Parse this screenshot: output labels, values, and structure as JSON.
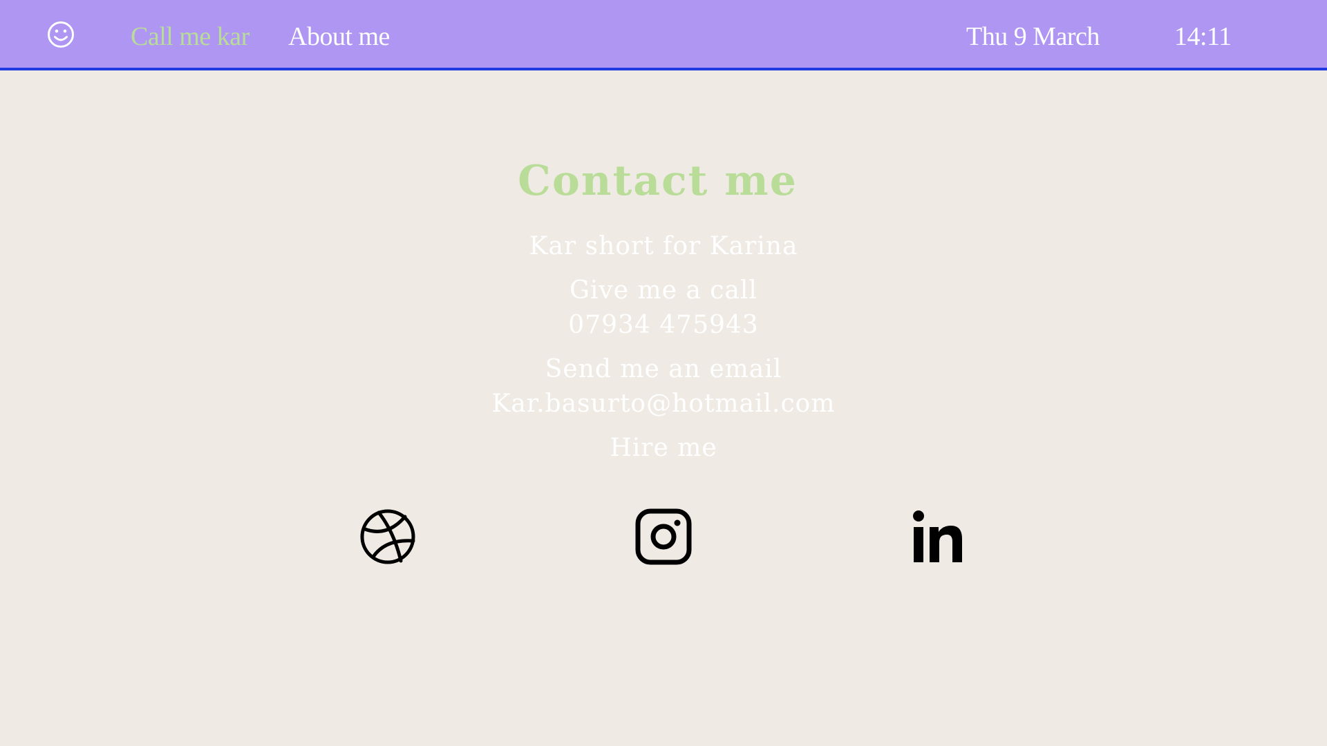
{
  "header": {
    "logo_icon": "smiley-icon",
    "nav": {
      "home_label": "Call me kar",
      "about_label": "About me"
    },
    "date": "Thu 9 March",
    "time": "14:11"
  },
  "contact": {
    "title": "Contact me",
    "name_line": "Kar short for Karina",
    "call_label": "Give me a call",
    "phone": "07934 475943",
    "email_label": "Send me an email",
    "email": "Kar.basurto@hotmail.com",
    "hire_label": "Hire me"
  },
  "social": [
    {
      "icon": "dribbble-icon"
    },
    {
      "icon": "instagram-icon"
    },
    {
      "icon": "linkedin-icon"
    }
  ],
  "colors": {
    "header_bg": "#ae96f2",
    "header_border": "#1f3be0",
    "page_bg": "#efebe4",
    "accent_green": "#b9dd98",
    "text_white": "#ffffff",
    "icon_black": "#000000"
  }
}
